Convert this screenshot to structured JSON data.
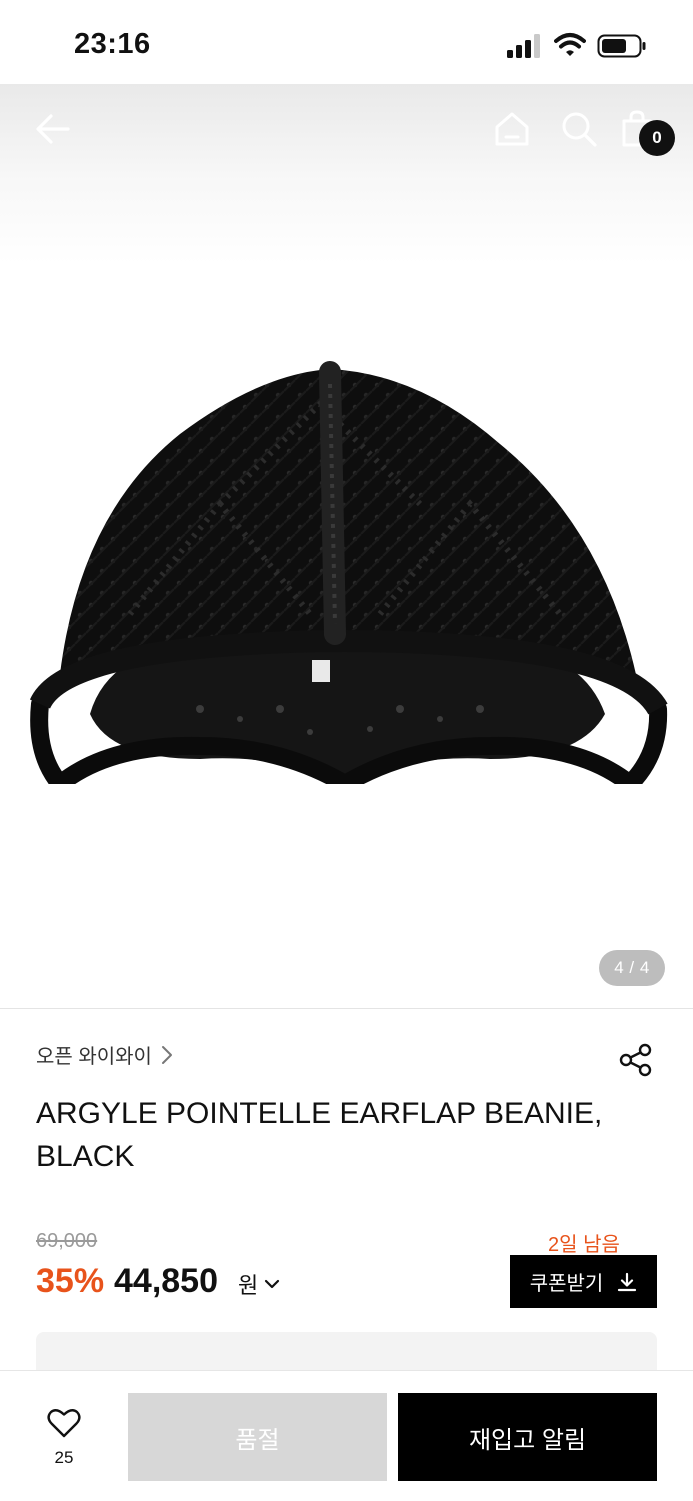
{
  "status_bar": {
    "time": "23:16"
  },
  "nav": {
    "cart_count": "0"
  },
  "gallery": {
    "indicator": "4 / 4"
  },
  "product": {
    "brand": "오픈 와이와이",
    "title": "ARGYLE POINTELLE EARFLAP BEANIE, BLACK",
    "original_price": "69,000",
    "discount": "35%",
    "price": "44,850",
    "currency": "원",
    "days_left": "2일 남음",
    "coupon_label": "쿠폰받기"
  },
  "bottom": {
    "like_count": "25",
    "soldout_label": "품절",
    "restock_label": "재입고 알림"
  },
  "colors": {
    "accent": "#e8531b",
    "black": "#000000",
    "soldout": "#d7d7d7"
  }
}
